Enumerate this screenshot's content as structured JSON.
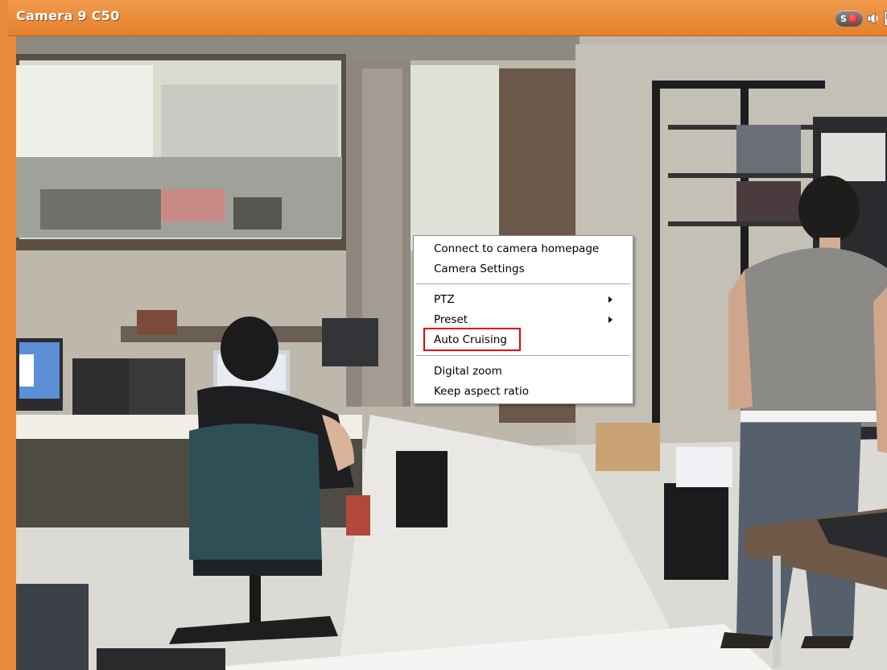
{
  "window": {
    "title": "Camera 9 C50"
  },
  "title_icons": {
    "record_letter": "S",
    "items": [
      "record-icon",
      "speaker-icon",
      "snapshot-icon"
    ]
  },
  "context_menu": {
    "items": [
      {
        "label": "Connect to camera homepage",
        "submenu": false
      },
      {
        "label": "Camera Settings",
        "submenu": false
      },
      {
        "label": "PTZ",
        "submenu": true
      },
      {
        "label": "Preset",
        "submenu": true
      },
      {
        "label": "Auto Cruising",
        "submenu": false,
        "highlighted": true
      },
      {
        "label": "Digital zoom",
        "submenu": false
      },
      {
        "label": "Keep aspect ratio",
        "submenu": false
      }
    ]
  },
  "colors": {
    "title_bar": "#e88a3c",
    "highlight_box": "#e60000"
  }
}
